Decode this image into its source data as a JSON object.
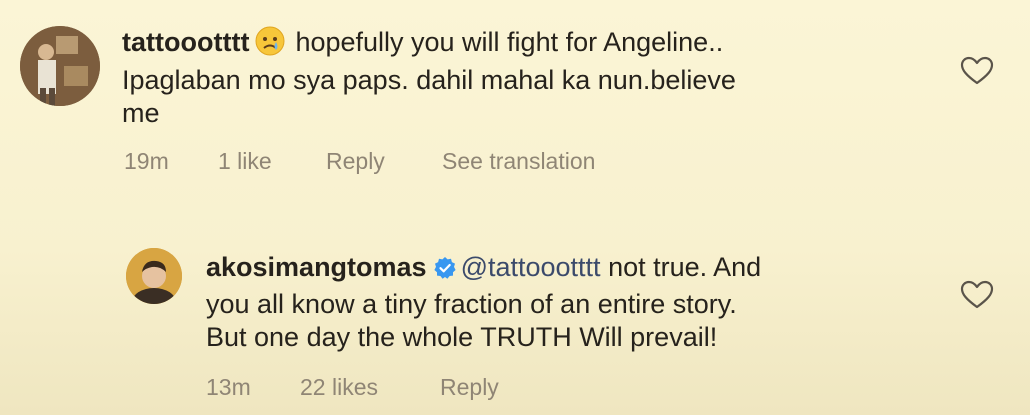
{
  "comments": [
    {
      "username": "tattoootttt",
      "text": "hopefully you will fight for Angeline.. Ipaglaban mo sya paps. dahil mahal ka nun.believe me",
      "line1": "hopefully you will fight for Angeline..",
      "line2": "Ipaglaban mo sya paps. dahil mahal ka nun.believe",
      "line3": "me",
      "emoji": "crying-face",
      "time": "19m",
      "likes": "1 like",
      "reply": "Reply",
      "translation": "See translation"
    },
    {
      "username": "akosimangtomas",
      "verified": true,
      "mention": "@tattoootttt",
      "line1": "not true. And",
      "line2": "you all know a tiny fraction of an entire story.",
      "line3": "But one day the whole TRUTH Will prevail!",
      "time": "13m",
      "likes": "22 likes",
      "reply": "Reply"
    }
  ],
  "icons": {
    "like": "heart-outline-icon",
    "verified": "verified-badge-icon"
  },
  "colors": {
    "background": "#fbf5d6",
    "meta": "#8f8575",
    "verified": "#3897f0"
  }
}
